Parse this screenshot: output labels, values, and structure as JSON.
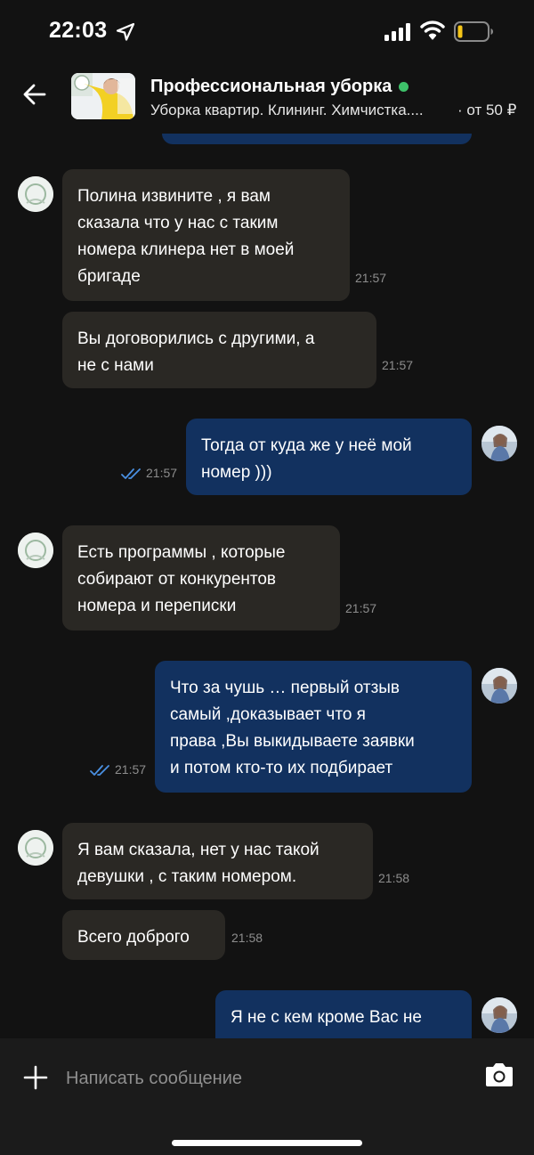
{
  "status_bar": {
    "time": "22:03",
    "icons": [
      "location-arrow-icon",
      "cellular-signal-icon",
      "wifi-icon",
      "battery-low-icon"
    ]
  },
  "header": {
    "title": "Профессиональная уборка",
    "subtitle": "Уборка квартир. Клининг. Химчистка....",
    "price": "· от 50 ₽",
    "online": true,
    "online_color": "#3ec16a"
  },
  "messages": [
    {
      "direction": "in",
      "text": "Полина извините , я вам\nсказала что у нас с таким\nномера клинера нет в моей\nбригаде",
      "time": "21:57"
    },
    {
      "direction": "in",
      "text": "Вы договорились с другими, а\nне с нами",
      "time": "21:57"
    },
    {
      "direction": "out",
      "text": "Тогда от куда же у неё мой\nномер )))",
      "time": "21:57",
      "read": true
    },
    {
      "direction": "in",
      "text": "Есть программы , которые\nсобирают от конкурентов\nномера и переписки",
      "time": "21:57"
    },
    {
      "direction": "out",
      "text": "Что за чушь … первый отзыв\nсамый ,доказывает что я\nправа ,Вы выкидываете заявки\nи потом кто-то их подбирает",
      "time": "21:57",
      "read": true
    },
    {
      "direction": "in",
      "text": "Я вам сказала, нет у нас такой\nдевушки , с таким номером.",
      "time": "21:58"
    },
    {
      "direction": "in",
      "text": "Всего доброго",
      "time": "21:58"
    },
    {
      "direction": "out",
      "text": "Я не с кем кроме Вас не",
      "time": ""
    }
  ],
  "input": {
    "placeholder": "Написать сообщение",
    "value": ""
  },
  "colors": {
    "background": "#121212",
    "incoming_bubble": "#2a2824",
    "outgoing_bubble": "#12315f",
    "read_ticks": "#4a90e2",
    "timestamp": "#8d8d8d"
  }
}
